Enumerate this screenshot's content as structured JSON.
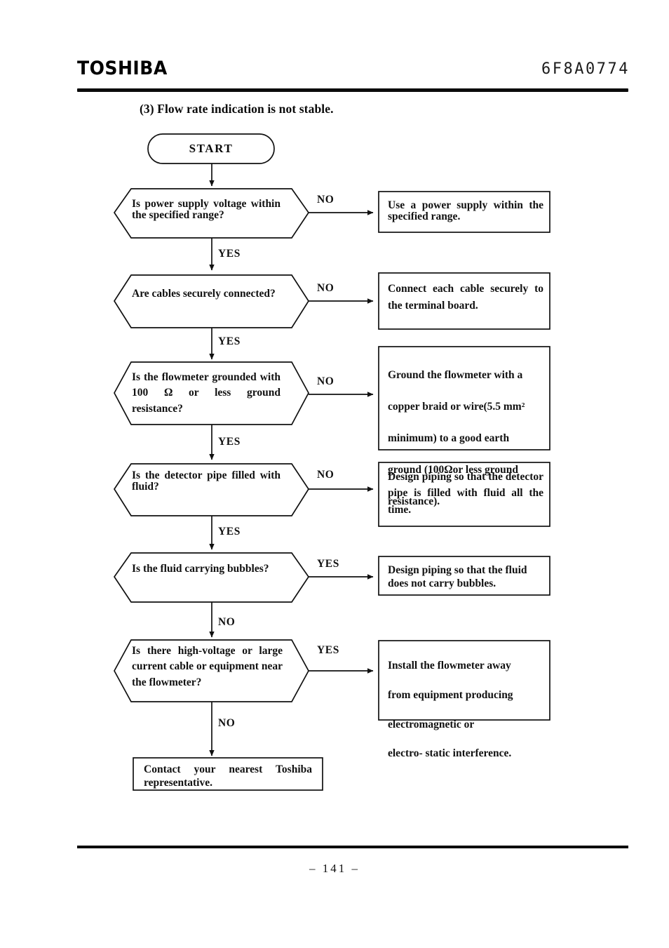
{
  "header": {
    "brand": "TOSHIBA",
    "document_number": "6F8A0774"
  },
  "section": {
    "title": "(3) Flow rate indication is not stable."
  },
  "flowchart": {
    "start": {
      "label": "START"
    },
    "steps": [
      {
        "id": "power-supply",
        "question": "Is  power  supply  voltage within the specified range?",
        "branch_to_action": "NO",
        "branch_continue": "YES",
        "action": "Use  a  power  supply  within the specified range."
      },
      {
        "id": "cables-connected",
        "question": "Are    cables    securely connected?",
        "branch_to_action": "NO",
        "branch_continue": "YES",
        "action": "Connect  each  cable  securely to the terminal board."
      },
      {
        "id": "grounding",
        "question": "Is  the  flowmeter  grounded with  100 Ω or  less  ground resistance?",
        "branch_to_action": "NO",
        "branch_continue": "YES",
        "action_lines": [
          "Ground the flowmeter with a",
          "copper braid or wire(5.5 mm²",
          "minimum)  to  a  good  earth",
          "ground (100Ωor less ground",
          "resistance)."
        ]
      },
      {
        "id": "detector-pipe-filled",
        "question": "Is  the  detector  pipe  filled with fluid?",
        "branch_to_action": "NO",
        "branch_continue": "YES",
        "action": "Design  piping  so  that  the detector pipe is filled with fluid all the time."
      },
      {
        "id": "fluid-bubbles",
        "question": "Is the fluid carrying bubbles?",
        "branch_to_action": "YES",
        "branch_continue": "NO",
        "action": "Design piping so that the fluid does not carry bubbles."
      },
      {
        "id": "interference",
        "question": "Is there high-voltage or large current  cable  or  equipment near the flowmeter?",
        "branch_to_action": "YES",
        "branch_continue": "NO",
        "action_lines": [
          "Install the flowmeter away",
          "from equipment producing",
          "electromagnetic or",
          "electro- static interference."
        ]
      }
    ],
    "end": {
      "text": "Contact  your  nearest  Toshiba representative."
    }
  },
  "footer": {
    "page": "–   141   –"
  }
}
